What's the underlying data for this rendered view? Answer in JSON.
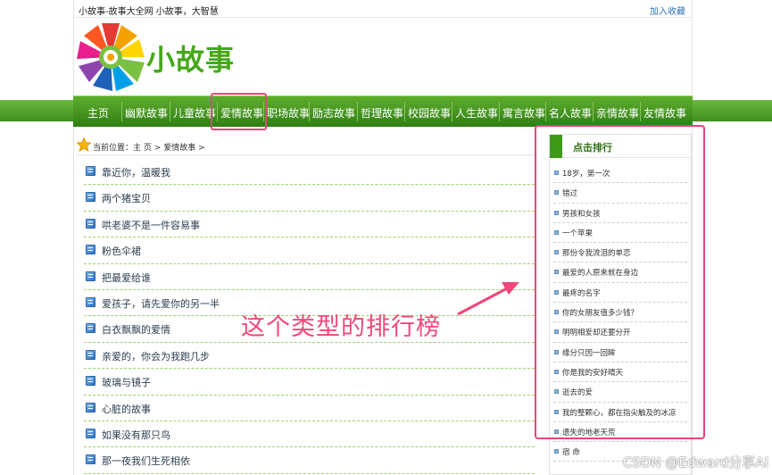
{
  "topbar": {
    "slogan": "小故事-故事大全网 小故事，大智慧",
    "favorite": "加入收藏"
  },
  "logo": {
    "text": "小故事"
  },
  "nav": {
    "items": [
      "主页",
      "幽默故事",
      "儿童故事",
      "爱情故事",
      "职场故事",
      "励志故事",
      "哲理故事",
      "校园故事",
      "人生故事",
      "寓言故事",
      "名人故事",
      "亲情故事",
      "友情故事"
    ],
    "active_index": 3
  },
  "breadcrumb": {
    "prefix": "当前位置：",
    "home": "主 页",
    "sep1": ">",
    "category": "爱情故事",
    "sep2": ">"
  },
  "stories": [
    "靠近你，温暖我",
    "两个猪宝贝",
    "哄老婆不是一件容易事",
    "粉色伞裙",
    "把最爱给谁",
    "爱孩子，请先爱你的另一半",
    "白衣飘飘的爱情",
    "亲爱的，你会为我跑几步",
    "玻璃与镜子",
    "心脏的故事",
    "如果没有那只鸟",
    "那一夜我们生死相依"
  ],
  "ranking": {
    "title": "点击排行",
    "items": [
      "18岁，第一次",
      "错过",
      "男孩和女孩",
      "一个苹果",
      "那份令我流泪的单恋",
      "最爱的人原来就在身边",
      "最疼的名字",
      "你的女朋友值多少钱？",
      "明明相爱却还要分开",
      "缘分只因一回眸",
      "你是我的安好晴天",
      "逝去的爱",
      "我的整颗心，都在指尖触及的冰凉",
      "遗失的地老天荒",
      "宿 命"
    ]
  },
  "annotation": "这个类型的排行榜",
  "watermark": "CSDN @Edward分享AI",
  "colors": {
    "accent_green": "#3f9a18",
    "highlight_pink": "#e8457a",
    "link_blue": "#2b74b8"
  }
}
